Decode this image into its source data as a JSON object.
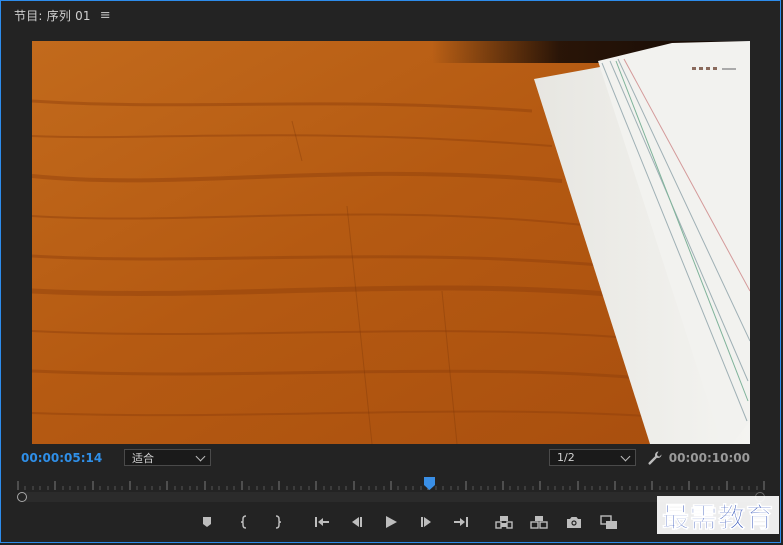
{
  "panel": {
    "title": "节目: 序列 01",
    "menu_icon": "hamburger-icon"
  },
  "timecode": {
    "current": "00:00:05:14",
    "duration": "00:00:10:00"
  },
  "zoom": {
    "selected": "适合"
  },
  "resolution": {
    "selected": "1/2"
  },
  "playhead": {
    "position": 0.514
  },
  "transport": {
    "buttons": [
      {
        "name": "add-marker",
        "icon": "marker-icon"
      },
      {
        "name": "mark-in",
        "icon": "mark-in-icon"
      },
      {
        "name": "mark-out",
        "icon": "mark-out-icon"
      },
      {
        "name": "go-to-in",
        "icon": "go-to-in-icon"
      },
      {
        "name": "step-back",
        "icon": "step-back-icon"
      },
      {
        "name": "play",
        "icon": "play-icon"
      },
      {
        "name": "step-forward",
        "icon": "step-forward-icon"
      },
      {
        "name": "go-to-out",
        "icon": "go-to-out-icon"
      },
      {
        "name": "lift",
        "icon": "lift-icon"
      },
      {
        "name": "extract",
        "icon": "extract-icon"
      },
      {
        "name": "export-frame",
        "icon": "camera-icon"
      },
      {
        "name": "comparison-view",
        "icon": "compare-icon"
      }
    ]
  },
  "colors": {
    "accent": "#2f8fe8",
    "panel_bg": "#232323",
    "border": "#2d8ceb"
  },
  "watermark": {
    "text": "最需教育"
  }
}
